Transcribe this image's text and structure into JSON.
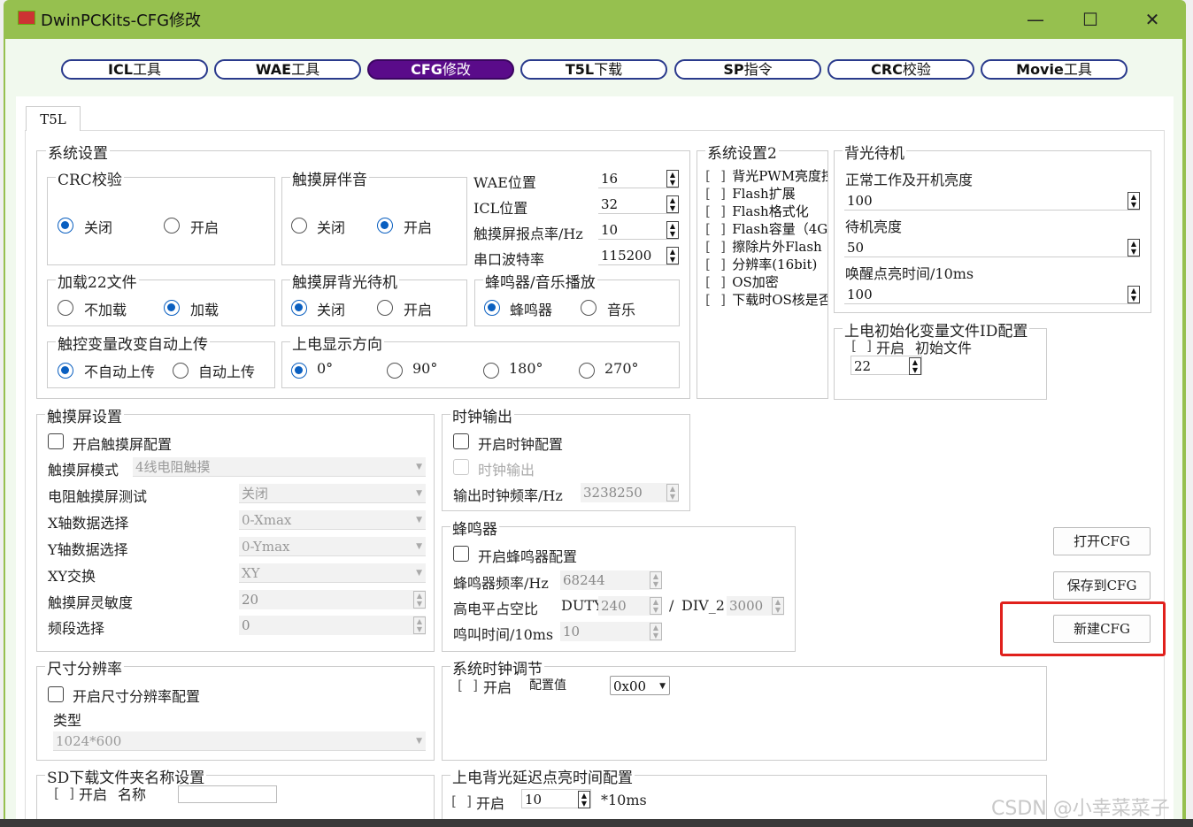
{
  "window": {
    "title": "DwinPCKits-CFG修改",
    "controls": {
      "minimize": "—",
      "maximize": "☐",
      "close": "✕"
    }
  },
  "nav": [
    {
      "bold": "ICL",
      "light": "工具"
    },
    {
      "bold": "WAE",
      "light": "工具"
    },
    {
      "bold": "CFG",
      "light": "修改"
    },
    {
      "bold": "T5L",
      "light": "下载"
    },
    {
      "bold": "SP",
      "light": "指令"
    },
    {
      "bold": "CRC",
      "light": "校验"
    },
    {
      "bold": "Movie",
      "light": "工具"
    }
  ],
  "active_nav": "CFG修改",
  "tab": "T5L",
  "sys": {
    "title": "系统设置",
    "crc": {
      "title": "CRC校验",
      "off": "关闭",
      "on": "开启",
      "selected": "关闭"
    },
    "touch_sound": {
      "title": "触摸屏伴音",
      "off": "关闭",
      "on": "开启",
      "selected": "开启"
    },
    "wae_pos": {
      "label": "WAE位置",
      "value": "16"
    },
    "icl_pos": {
      "label": "ICL位置",
      "value": "32"
    },
    "touch_rate": {
      "label": "触摸屏报点率/Hz",
      "value": "10"
    },
    "baud": {
      "label": "串口波特率",
      "value": "115200"
    },
    "load22": {
      "title": "加载22文件",
      "no": "不加载",
      "yes": "加载",
      "selected": "加载"
    },
    "backlight_standby": {
      "title": "触摸屏背光待机",
      "off": "关闭",
      "on": "开启",
      "selected": "关闭"
    },
    "buzzer_music": {
      "title": "蜂鸣器/音乐播放",
      "buzzer": "蜂鸣器",
      "music": "音乐",
      "selected": "蜂鸣器"
    },
    "auto_upload": {
      "title": "触控变量改变自动上传",
      "no": "不自动上传",
      "yes": "自动上传",
      "selected": "不自动上传"
    },
    "display_dir": {
      "title": "上电显示方向",
      "d0": "0°",
      "d90": "90°",
      "d180": "180°",
      "d270": "270°",
      "selected": "0°"
    }
  },
  "sys2": {
    "title": "系统设置2",
    "items": [
      "背光PWM亮度控",
      "Flash扩展",
      "Flash格式化",
      "Flash容量（4G",
      "擦除片外Flash",
      "分辨率(16bit)",
      "OS加密",
      "下载时OS核是否"
    ]
  },
  "backlight": {
    "title": "背光待机",
    "normal": {
      "label": "正常工作及开机亮度",
      "value": "100"
    },
    "standby": {
      "label": "待机亮度",
      "value": "50"
    },
    "wake": {
      "label": "唤醒点亮时间/10ms",
      "value": "100"
    }
  },
  "init_var": {
    "title": "上电初始化变量文件ID配置",
    "enable": "开启",
    "file": "初始文件",
    "value": "22"
  },
  "touch": {
    "title": "触摸屏设置",
    "enable": "开启触摸屏配置",
    "mode": {
      "label": "触摸屏模式",
      "value": "4线电阻触摸"
    },
    "test": {
      "label": "电阻触摸屏测试",
      "value": "关闭"
    },
    "xsel": {
      "label": "X轴数据选择",
      "value": "0-Xmax"
    },
    "ysel": {
      "label": "Y轴数据选择",
      "value": "0-Ymax"
    },
    "xy": {
      "label": "XY交换",
      "value": "XY"
    },
    "sens": {
      "label": "触摸屏灵敏度",
      "value": "20"
    },
    "band": {
      "label": "频段选择",
      "value": "0"
    }
  },
  "clock": {
    "title": "时钟输出",
    "enable": "开启时钟配置",
    "output": "时钟输出",
    "freq": {
      "label": "输出时钟频率/Hz",
      "value": "3238250"
    }
  },
  "buzzer": {
    "title": "蜂鸣器",
    "enable": "开启蜂鸣器配置",
    "freq": {
      "label": "蜂鸣器频率/Hz",
      "value": "68244"
    },
    "duty": {
      "label": "高电平占空比",
      "duty_label": "DUTY",
      "duty": "240",
      "sep": "/",
      "div_label": "DIV_2",
      "div": "3000"
    },
    "time": {
      "label": "鸣叫时间/10ms",
      "value": "10"
    }
  },
  "size": {
    "title": "尺寸分辨率",
    "enable": "开启尺寸分辨率配置",
    "type_label": "类型",
    "type_value": "1024*600"
  },
  "sysclock": {
    "title": "系统时钟调节",
    "enable": "开启",
    "config_label": "配置值",
    "value": "0x00"
  },
  "sd": {
    "title": "SD下载文件夹名称设置",
    "enable": "开启",
    "name_label": "名称"
  },
  "poweron_bl": {
    "title": "上电背光延迟点亮时间配置",
    "enable": "开启",
    "value": "10",
    "unit": "*10ms"
  },
  "buttons": {
    "open": "打开CFG",
    "save": "保存到CFG",
    "new": "新建CFG"
  },
  "watermark": "CSDN @小幸菜菜子",
  "colors": {
    "titlebar": "#96c04f",
    "active_nav": "#5a0b8a",
    "radio": "#0a5fc0",
    "highlight": "#e0201c"
  }
}
